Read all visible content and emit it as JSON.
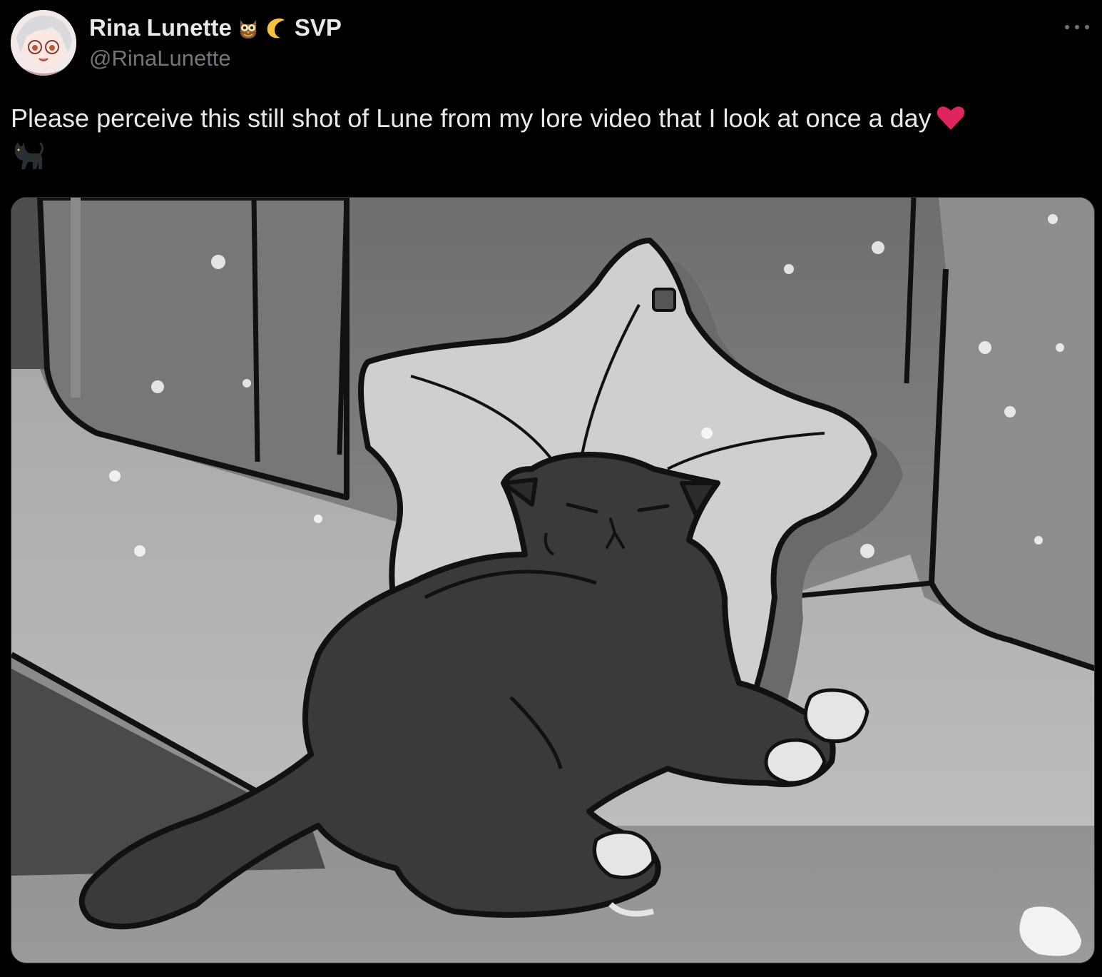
{
  "author": {
    "display_name": "Rina Lunette",
    "name_emojis": [
      "owl-emoji",
      "crescent-moon-emoji"
    ],
    "name_suffix": "SVP",
    "handle": "@RinaLunette"
  },
  "tweet": {
    "text": "Please perceive this still shot of Lune from my lore video that I look at once a day",
    "trailing_emojis": [
      "red-heart-emoji",
      "black-cat-emoji"
    ]
  },
  "media": {
    "type": "image",
    "subject": "illustration"
  },
  "colors": {
    "background": "#000000",
    "text_primary": "#e7e9ea",
    "text_secondary": "#71767b",
    "heart": "#e0245e"
  },
  "icons": {
    "more": "more-icon"
  }
}
